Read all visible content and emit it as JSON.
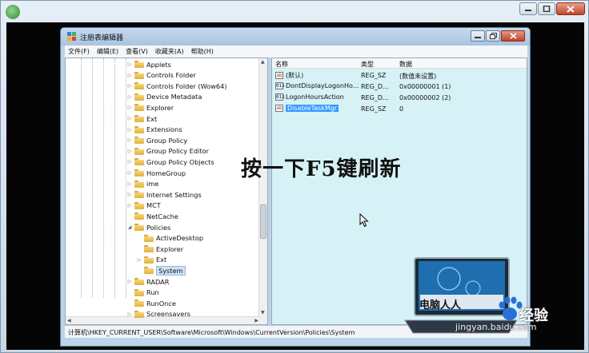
{
  "regedit": {
    "title": "注册表编辑器",
    "menu": [
      "文件(F)",
      "编辑(E)",
      "查看(V)",
      "收藏夹(A)",
      "帮助(H)"
    ],
    "tree": [
      {
        "label": "Applets",
        "indent": 0,
        "expander": "▷"
      },
      {
        "label": "Controls Folder",
        "indent": 0,
        "expander": "▷"
      },
      {
        "label": "Controls Folder (Wow64)",
        "indent": 0,
        "expander": "▷"
      },
      {
        "label": "Device Metadata",
        "indent": 0,
        "expander": "▷"
      },
      {
        "label": "Explorer",
        "indent": 0,
        "expander": "▷"
      },
      {
        "label": "Ext",
        "indent": 0,
        "expander": "▷"
      },
      {
        "label": "Extensions",
        "indent": 0,
        "expander": "▷"
      },
      {
        "label": "Group Policy",
        "indent": 0,
        "expander": "▷"
      },
      {
        "label": "Group Policy Editor",
        "indent": 0,
        "expander": "▷"
      },
      {
        "label": "Group Policy Objects",
        "indent": 0,
        "expander": "▷"
      },
      {
        "label": "HomeGroup",
        "indent": 0,
        "expander": "▷"
      },
      {
        "label": "ime",
        "indent": 0,
        "expander": "▷"
      },
      {
        "label": "Internet Settings",
        "indent": 0,
        "expander": "▷"
      },
      {
        "label": "MCT",
        "indent": 0,
        "expander": "▷"
      },
      {
        "label": "NetCache",
        "indent": 0,
        "expander": ""
      },
      {
        "label": "Policies",
        "indent": 0,
        "expander": "◢"
      },
      {
        "label": "ActiveDesktop",
        "indent": 1,
        "expander": ""
      },
      {
        "label": "Explorer",
        "indent": 1,
        "expander": ""
      },
      {
        "label": "Ext",
        "indent": 1,
        "expander": "▷"
      },
      {
        "label": "System",
        "indent": 1,
        "expander": "",
        "selected": true
      },
      {
        "label": "RADAR",
        "indent": 0,
        "expander": "▷"
      },
      {
        "label": "Run",
        "indent": 0,
        "expander": ""
      },
      {
        "label": "RunOnce",
        "indent": 0,
        "expander": ""
      },
      {
        "label": "Screensavers",
        "indent": 0,
        "expander": "▷"
      }
    ],
    "columns": {
      "name": "名称",
      "type": "类型",
      "data": "数据"
    },
    "values": [
      {
        "icon": "ab",
        "name": "(默认)",
        "type": "REG_SZ",
        "data": "(数值未设置)"
      },
      {
        "icon": "011",
        "name": "DontDisplayLogonHo...",
        "type": "REG_D...",
        "data": "0x00000001 (1)"
      },
      {
        "icon": "011",
        "name": "LogonHoursAction",
        "type": "REG_D...",
        "data": "0x00000002 (2)"
      },
      {
        "icon": "ab",
        "name": "DisableTaskMgr",
        "type": "REG_SZ",
        "data": "0",
        "selected": true
      }
    ],
    "status_path": "计算机\\HKEY_CURRENT_USER\\Software\\Microsoft\\Windows\\CurrentVersion\\Policies\\System"
  },
  "overlay": {
    "instruction": "按一下F5键刷新"
  },
  "watermark": {
    "laptop_text": "电脑人人",
    "brand": "经验",
    "url": "jingyan.baidu.com"
  },
  "colors": {
    "list_bg": "#d6f2f6",
    "selection": "#3399ff",
    "chrome": "#bcd3ea"
  }
}
